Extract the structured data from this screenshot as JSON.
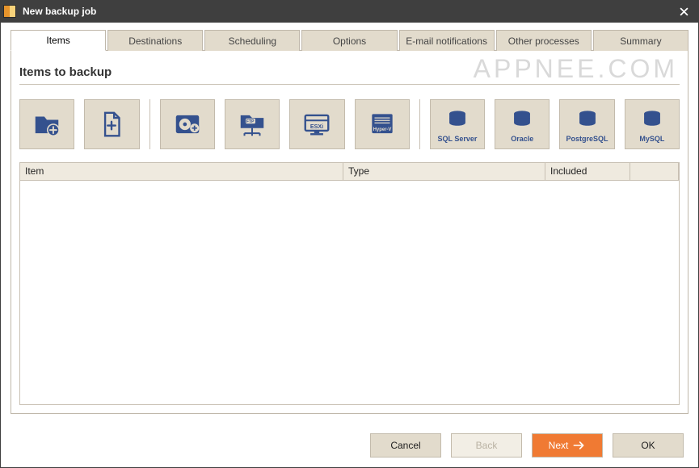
{
  "window": {
    "title": "New backup job"
  },
  "tabs": [
    {
      "label": "Items",
      "active": true
    },
    {
      "label": "Destinations",
      "active": false
    },
    {
      "label": "Scheduling",
      "active": false
    },
    {
      "label": "Options",
      "active": false
    },
    {
      "label": "E-mail notifications",
      "active": false
    },
    {
      "label": "Other processes",
      "active": false
    },
    {
      "label": "Summary",
      "active": false
    }
  ],
  "section": {
    "title": "Items to backup"
  },
  "sources": [
    {
      "name": "add-folder",
      "label": ""
    },
    {
      "name": "add-file",
      "label": ""
    },
    {
      "name": "disk-image",
      "label": ""
    },
    {
      "name": "ftp",
      "label": ""
    },
    {
      "name": "esxi",
      "label": ""
    },
    {
      "name": "hyper-v",
      "label": ""
    },
    {
      "name": "sqlserver",
      "label": "SQL Server"
    },
    {
      "name": "oracle",
      "label": "Oracle"
    },
    {
      "name": "postgresql",
      "label": "PostgreSQL"
    },
    {
      "name": "mysql",
      "label": "MySQL"
    }
  ],
  "grid": {
    "columns": {
      "item": "Item",
      "type": "Type",
      "included": "Included"
    },
    "rows": []
  },
  "footer": {
    "cancel": "Cancel",
    "back": "Back",
    "next": "Next",
    "ok": "OK"
  },
  "watermark": "APPNEE.COM"
}
